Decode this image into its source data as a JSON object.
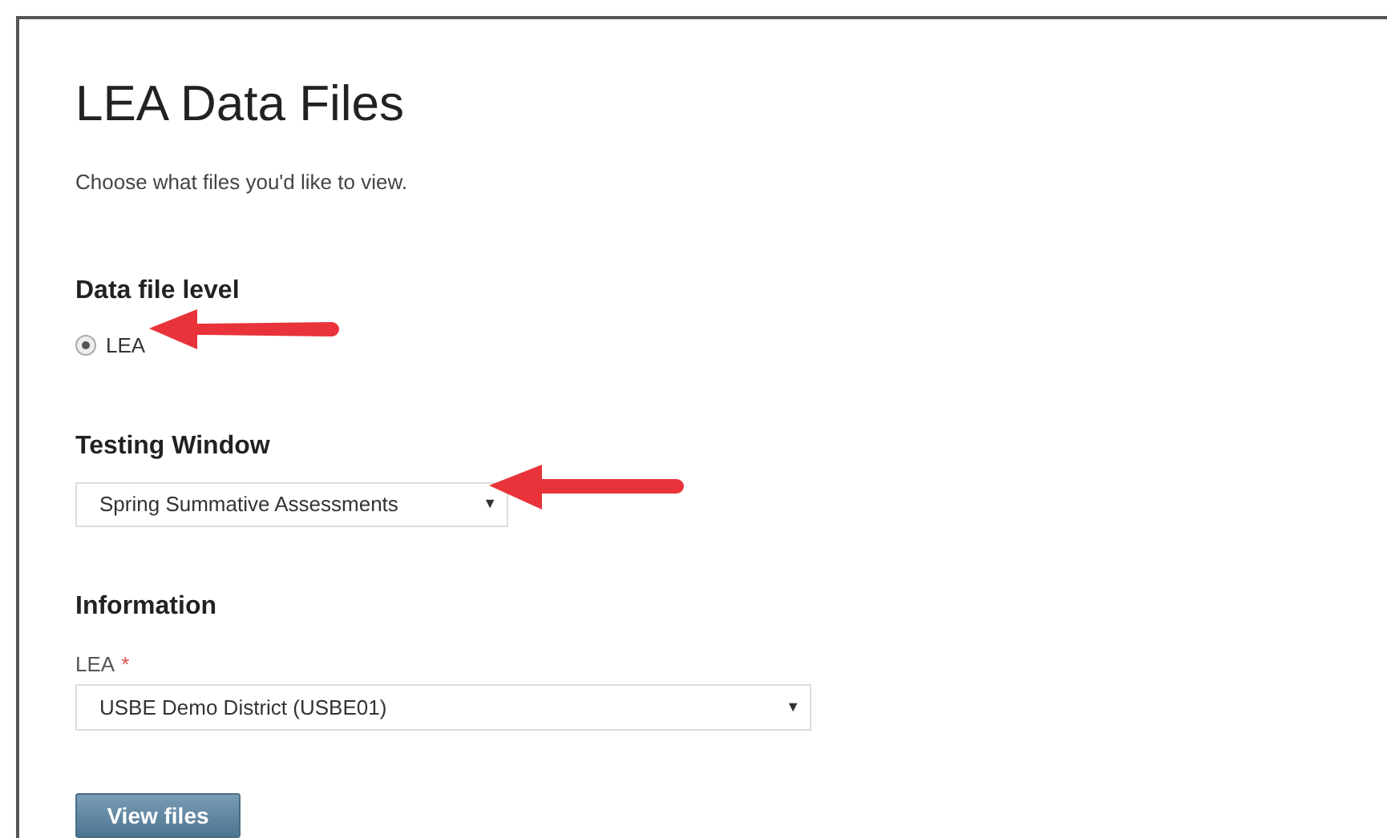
{
  "page": {
    "title": "LEA Data Files",
    "subtitle": "Choose what files you'd like to view."
  },
  "data_file_level": {
    "heading": "Data file level",
    "options": [
      {
        "label": "LEA",
        "selected": true
      }
    ]
  },
  "testing_window": {
    "heading": "Testing Window",
    "value": "Spring Summative Assessments",
    "caret": "▼"
  },
  "information": {
    "heading": "Information",
    "field_label": "LEA",
    "required_mark": "*",
    "value": "USBE Demo District (USBE01)",
    "caret": "▼"
  },
  "buttons": [
    "View files"
  ]
}
